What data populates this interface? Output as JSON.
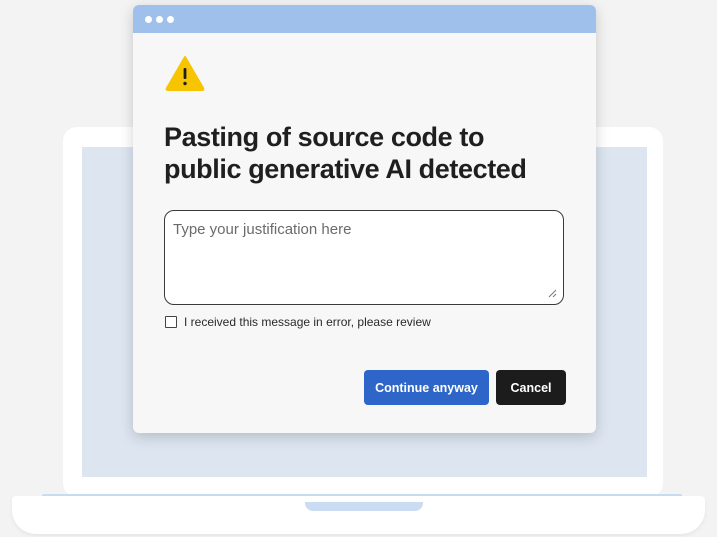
{
  "dialog": {
    "titlebar_dots": 3,
    "icon": "warning-triangle-icon",
    "headline_line1": "Pasting of source code to",
    "headline_line2": "public generative AI detected",
    "justification_placeholder": "Type your justification here",
    "justification_value": "",
    "error_checkbox_checked": false,
    "error_checkbox_label": "I received this message in error, please review",
    "continue_label": "Continue anyway",
    "cancel_label": "Cancel"
  },
  "colors": {
    "titlebar": "#9ec0ea",
    "warning": "#f6c400",
    "primary_button": "#2d65c8",
    "secondary_button": "#1c1c1c",
    "laptop_screen": "#dde5f1"
  }
}
